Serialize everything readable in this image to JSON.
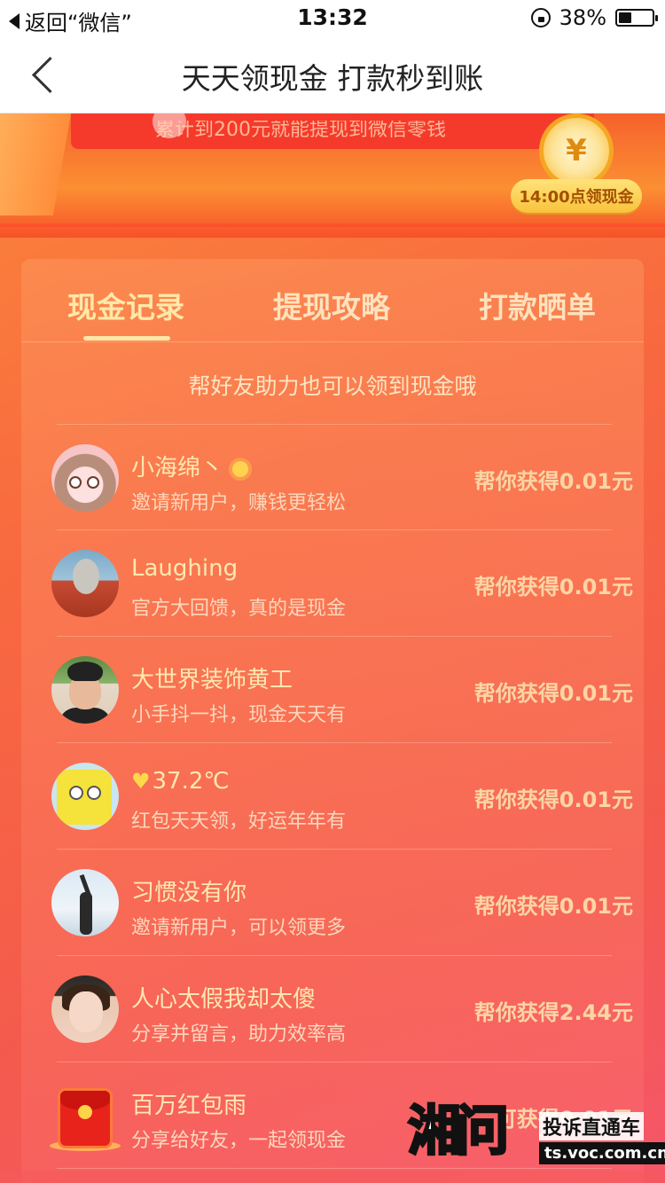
{
  "status_bar": {
    "back_label": "返回“微信”",
    "time": "13:32",
    "battery": "38%"
  },
  "nav": {
    "title": "天天领现金 打款秒到账"
  },
  "banner": {
    "text": "累计到200元就能提现到微信零钱",
    "clock_symbol": "¥",
    "clock_badge": "14:00点领现金"
  },
  "tabs": [
    {
      "label": "现金记录",
      "active": true
    },
    {
      "label": "提现攻略",
      "active": false
    },
    {
      "label": "打款晒单",
      "active": false
    }
  ],
  "hint": "帮好友助力也可以领到现金哦",
  "records": [
    {
      "name": "小海绵丶",
      "desc": "邀请新用户，赚钱更轻松",
      "reward": "帮你获得0.01元"
    },
    {
      "name": "Laughing",
      "desc": "官方大回馈，真的是现金",
      "reward": "帮你获得0.01元"
    },
    {
      "name": "大世界装饰黄工",
      "desc": "小手抖一抖，现金天天有",
      "reward": "帮你获得0.01元"
    },
    {
      "name": "37.2℃",
      "desc": "红包天天领，好运年年有",
      "reward": "帮你获得0.01元"
    },
    {
      "name": "习惯没有你",
      "desc": "邀请新用户，可以领更多",
      "reward": "帮你获得0.01元"
    },
    {
      "name": "人心太假我却太傻",
      "desc": "分享并留言，助力效率高",
      "reward": "帮你获得2.44元"
    },
    {
      "name": "百万红包雨",
      "desc": "分享给好友，一起领现金",
      "reward": "可获得0.01元"
    }
  ],
  "watermark": {
    "logo": "湘问",
    "title": "投诉直通车",
    "url": "ts.voc.com.cn"
  },
  "colors": {
    "accent_text": "#ffe8a8",
    "reward_text": "#fcd5a5",
    "nav_bg": "#ffffff"
  }
}
